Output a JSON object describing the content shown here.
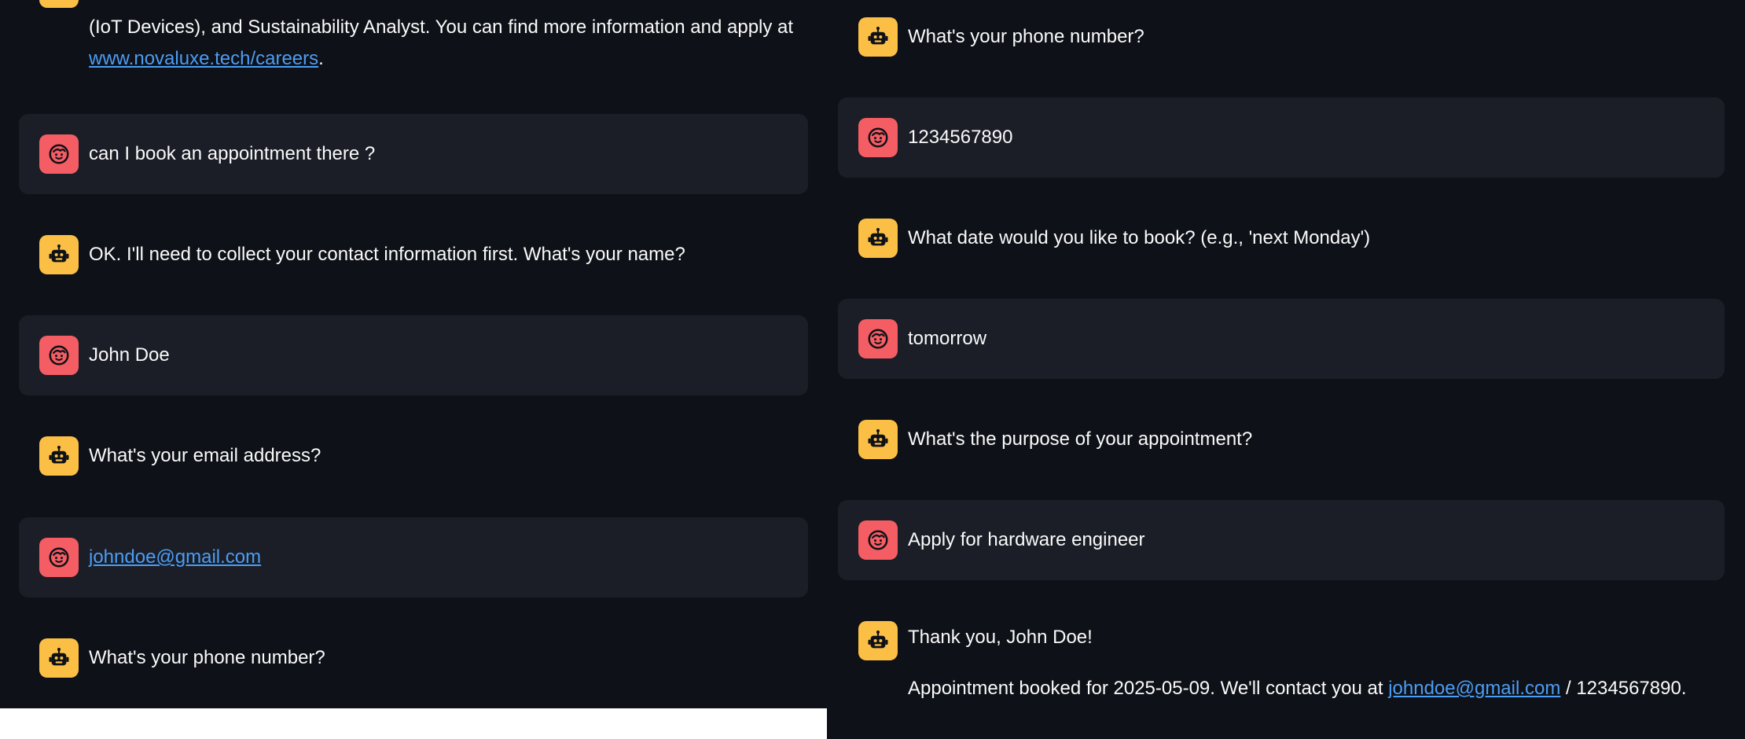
{
  "colors": {
    "background": "#0e1117",
    "user_bubble": "#1b1e27",
    "bot_avatar": "#fbbf45",
    "user_avatar": "#f45d63",
    "link": "#4c9df4",
    "text": "#fafafa"
  },
  "icons": {
    "bot": "robot-icon",
    "user": "face-icon"
  },
  "left_chat": [
    {
      "role": "assistant",
      "line1": "(IoT Devices), and Sustainability Analyst. You can find more information and apply at",
      "link": "www.novaluxe.tech/careers",
      "after_link": "."
    },
    {
      "role": "user",
      "text": "can I book an appointment there ?"
    },
    {
      "role": "assistant",
      "text": "OK. I'll need to collect your contact information first. What's your name?"
    },
    {
      "role": "user",
      "text": "John Doe"
    },
    {
      "role": "assistant",
      "text": "What's your email address?"
    },
    {
      "role": "user",
      "link": "johndoe@gmail.com"
    },
    {
      "role": "assistant",
      "text": "What's your phone number?"
    }
  ],
  "right_chat": [
    {
      "role": "assistant",
      "text": "What's your phone number?"
    },
    {
      "role": "user",
      "text": "1234567890"
    },
    {
      "role": "assistant",
      "text": "What date would you like to book? (e.g., 'next Monday')"
    },
    {
      "role": "user",
      "text": "tomorrow"
    },
    {
      "role": "assistant",
      "text": "What's the purpose of your appointment?"
    },
    {
      "role": "user",
      "text": "Apply for hardware engineer"
    },
    {
      "role": "assistant",
      "line1": "Thank you, John Doe!",
      "line2_before": "Appointment booked for 2025-05-09. We'll contact you at",
      "email_link": "johndoe@gmail.com",
      "line2_after": "/ 1234567890."
    }
  ]
}
